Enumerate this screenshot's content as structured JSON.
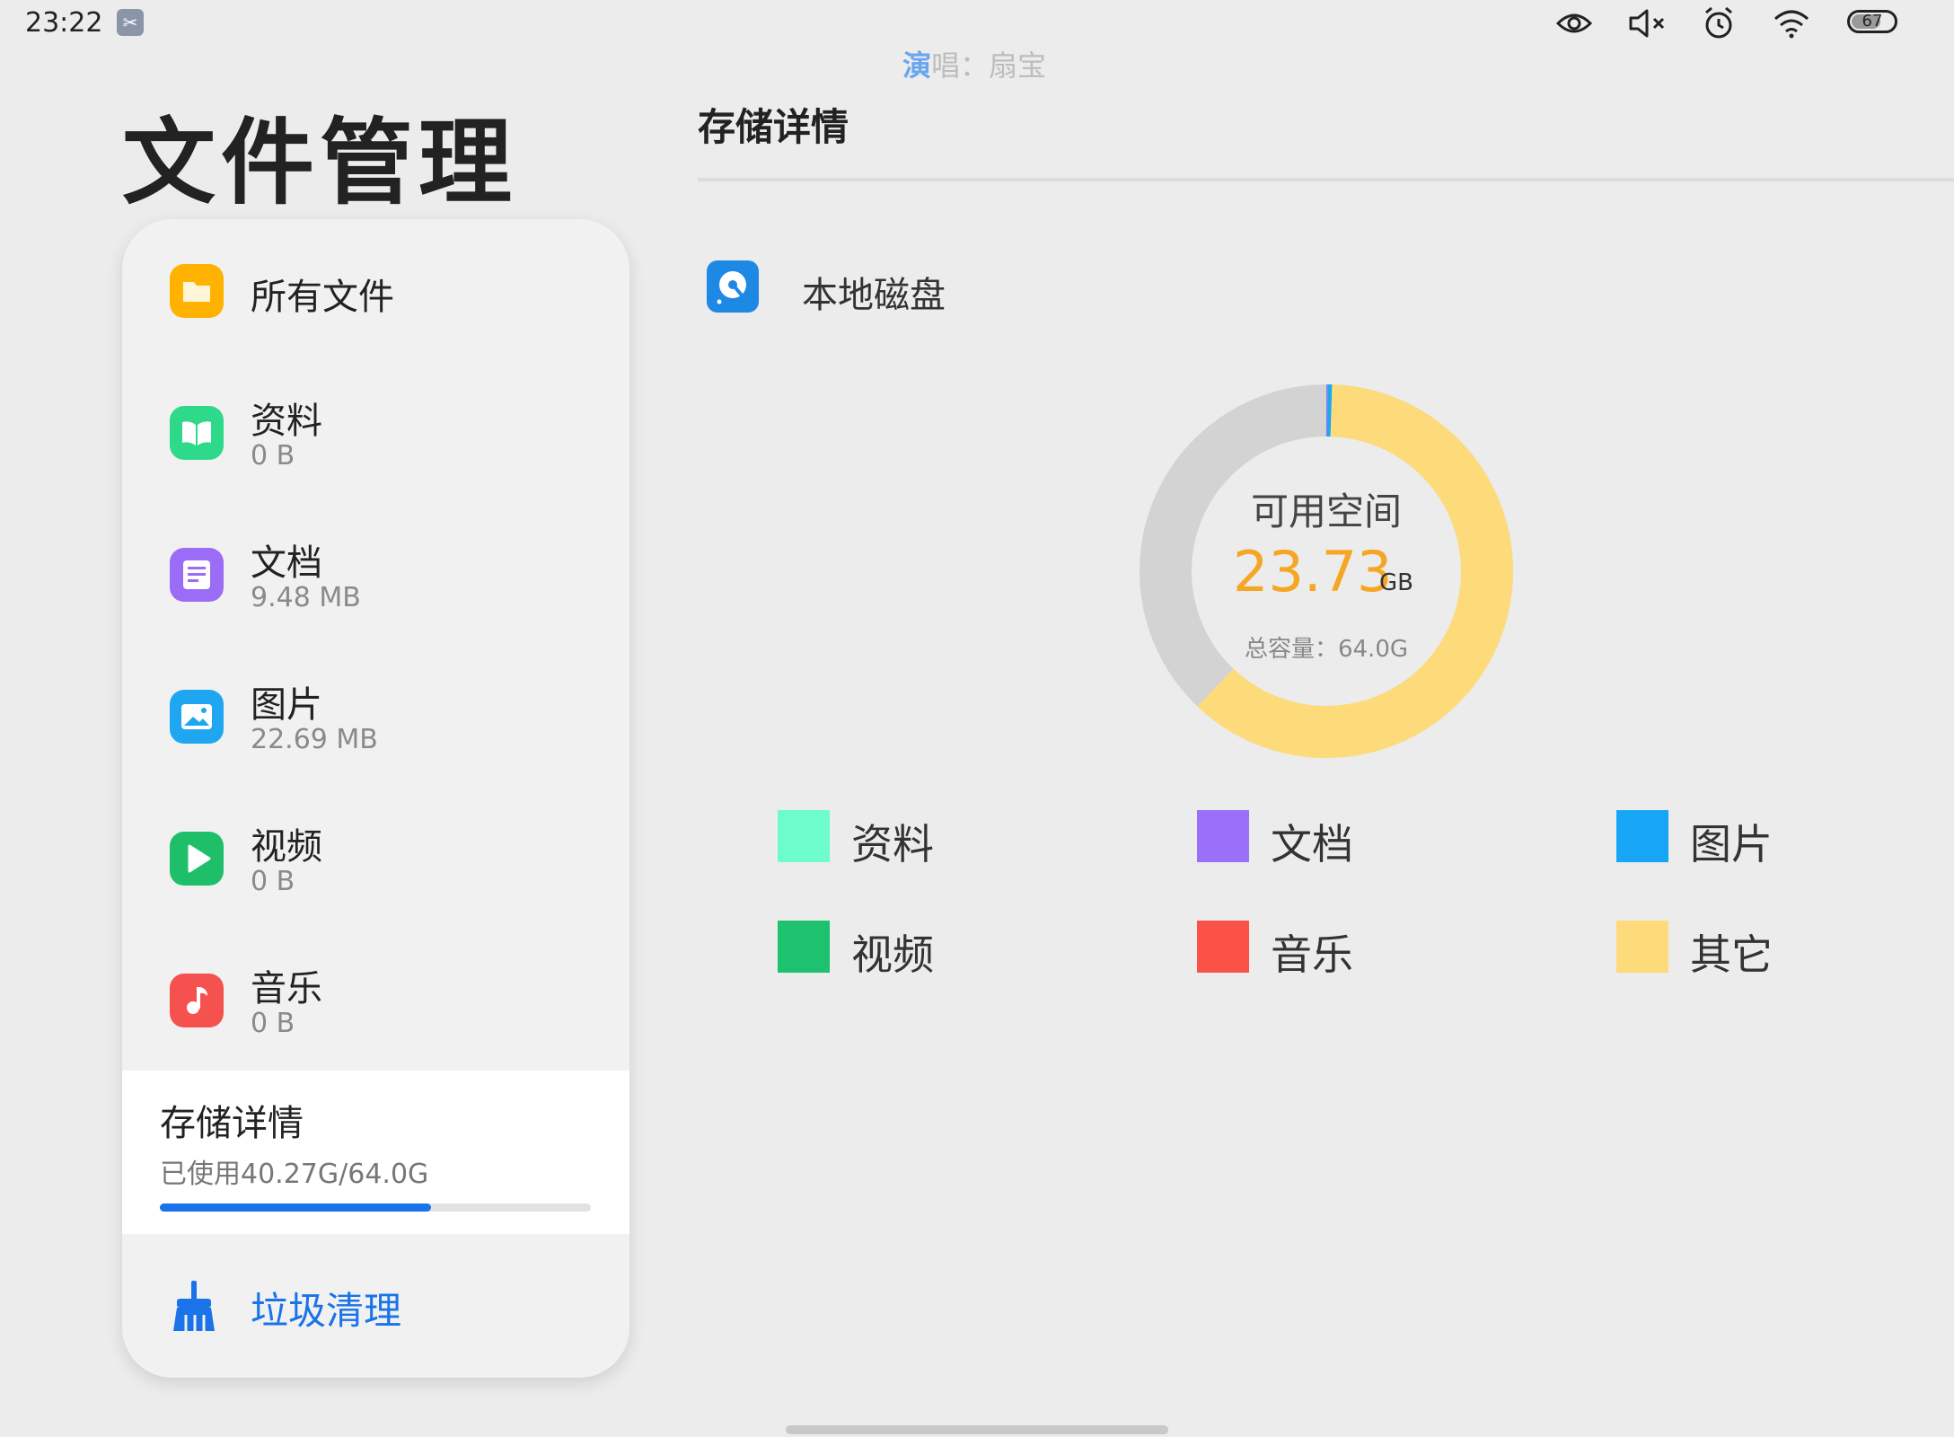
{
  "status_bar": {
    "time": "23:22",
    "icons": [
      "scissors-app-icon",
      "eye-icon",
      "mute-icon",
      "alarm-icon",
      "wifi-icon",
      "battery-icon"
    ],
    "battery": "67"
  },
  "lyric": {
    "highlight": "演",
    "rest": "唱：扇宝"
  },
  "app_title": "文件管理",
  "sidebar": {
    "items": [
      {
        "label": "所有文件",
        "sub": "",
        "icon": "folder-icon",
        "color": "#ffb300"
      },
      {
        "label": "资料",
        "sub": "0 B",
        "icon": "book-icon",
        "color": "#2fd98a"
      },
      {
        "label": "文档",
        "sub": "9.48 MB",
        "icon": "document-icon",
        "color": "#9b6cf5"
      },
      {
        "label": "图片",
        "sub": "22.69 MB",
        "icon": "image-icon",
        "color": "#1ea7f0"
      },
      {
        "label": "视频",
        "sub": "0 B",
        "icon": "play-icon",
        "color": "#1fbf6a"
      },
      {
        "label": "音乐",
        "sub": "0 B",
        "icon": "music-note-icon",
        "color": "#f5514e"
      }
    ],
    "storage": {
      "title": "存储详情",
      "used_text": "已使用40.27G/64.0G",
      "used_fraction": 0.629
    },
    "clean": {
      "label": "垃圾清理",
      "icon": "broom-icon"
    }
  },
  "detail": {
    "title": "存储详情",
    "disk_label": "本地磁盘",
    "disk_icon": "disk-icon",
    "available_label": "可用空间",
    "available_value": "23.73",
    "available_unit": "GB",
    "total_label": "总容量：64.0G",
    "usage_fractions": {
      "other": 0.616,
      "images": 0.004,
      "docs": 0.001,
      "free": 0.379
    },
    "colors": {
      "free": "#d3d3d3",
      "other": "#fedb7a",
      "images": "#1ea7f0",
      "docs": "#9b6cf5"
    },
    "legend": [
      {
        "label": "资料",
        "color": "#6dfccb"
      },
      {
        "label": "文档",
        "color": "#9a70f9"
      },
      {
        "label": "图片",
        "color": "#16a6f5"
      },
      {
        "label": "视频",
        "color": "#1ec16e"
      },
      {
        "label": "音乐",
        "color": "#fb5248"
      },
      {
        "label": "其它",
        "color": "#fedb7a"
      }
    ]
  }
}
